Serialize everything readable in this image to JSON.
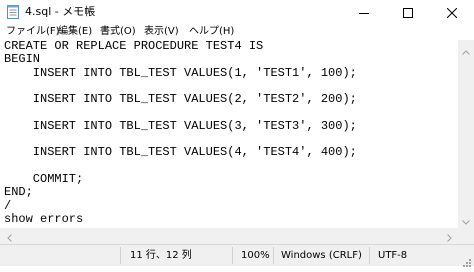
{
  "window": {
    "title": "4.sql - メモ帳"
  },
  "menu": {
    "items": [
      "ファイル(F)",
      "編集(E)",
      "書式(O)",
      "表示(V)",
      "ヘルプ(H)"
    ]
  },
  "editor": {
    "lines": [
      "CREATE OR REPLACE PROCEDURE TEST4 IS",
      "BEGIN",
      "    INSERT INTO TBL_TEST VALUES(1, 'TEST1', 100);",
      "",
      "    INSERT INTO TBL_TEST VALUES(2, 'TEST2', 200);",
      "",
      "    INSERT INTO TBL_TEST VALUES(3, 'TEST3', 300);",
      "",
      "    INSERT INTO TBL_TEST VALUES(4, 'TEST4', 400);",
      "",
      "    COMMIT;",
      "END;",
      "/",
      "show errors"
    ]
  },
  "status": {
    "position": "11 行、12 列",
    "zoom": "100%",
    "line_ending": "Windows (CRLF)",
    "encoding": "UTF-8"
  },
  "icons": {
    "app": "notepad-icon",
    "minimize": "minimize-icon",
    "maximize": "maximize-icon",
    "close": "close-icon"
  }
}
